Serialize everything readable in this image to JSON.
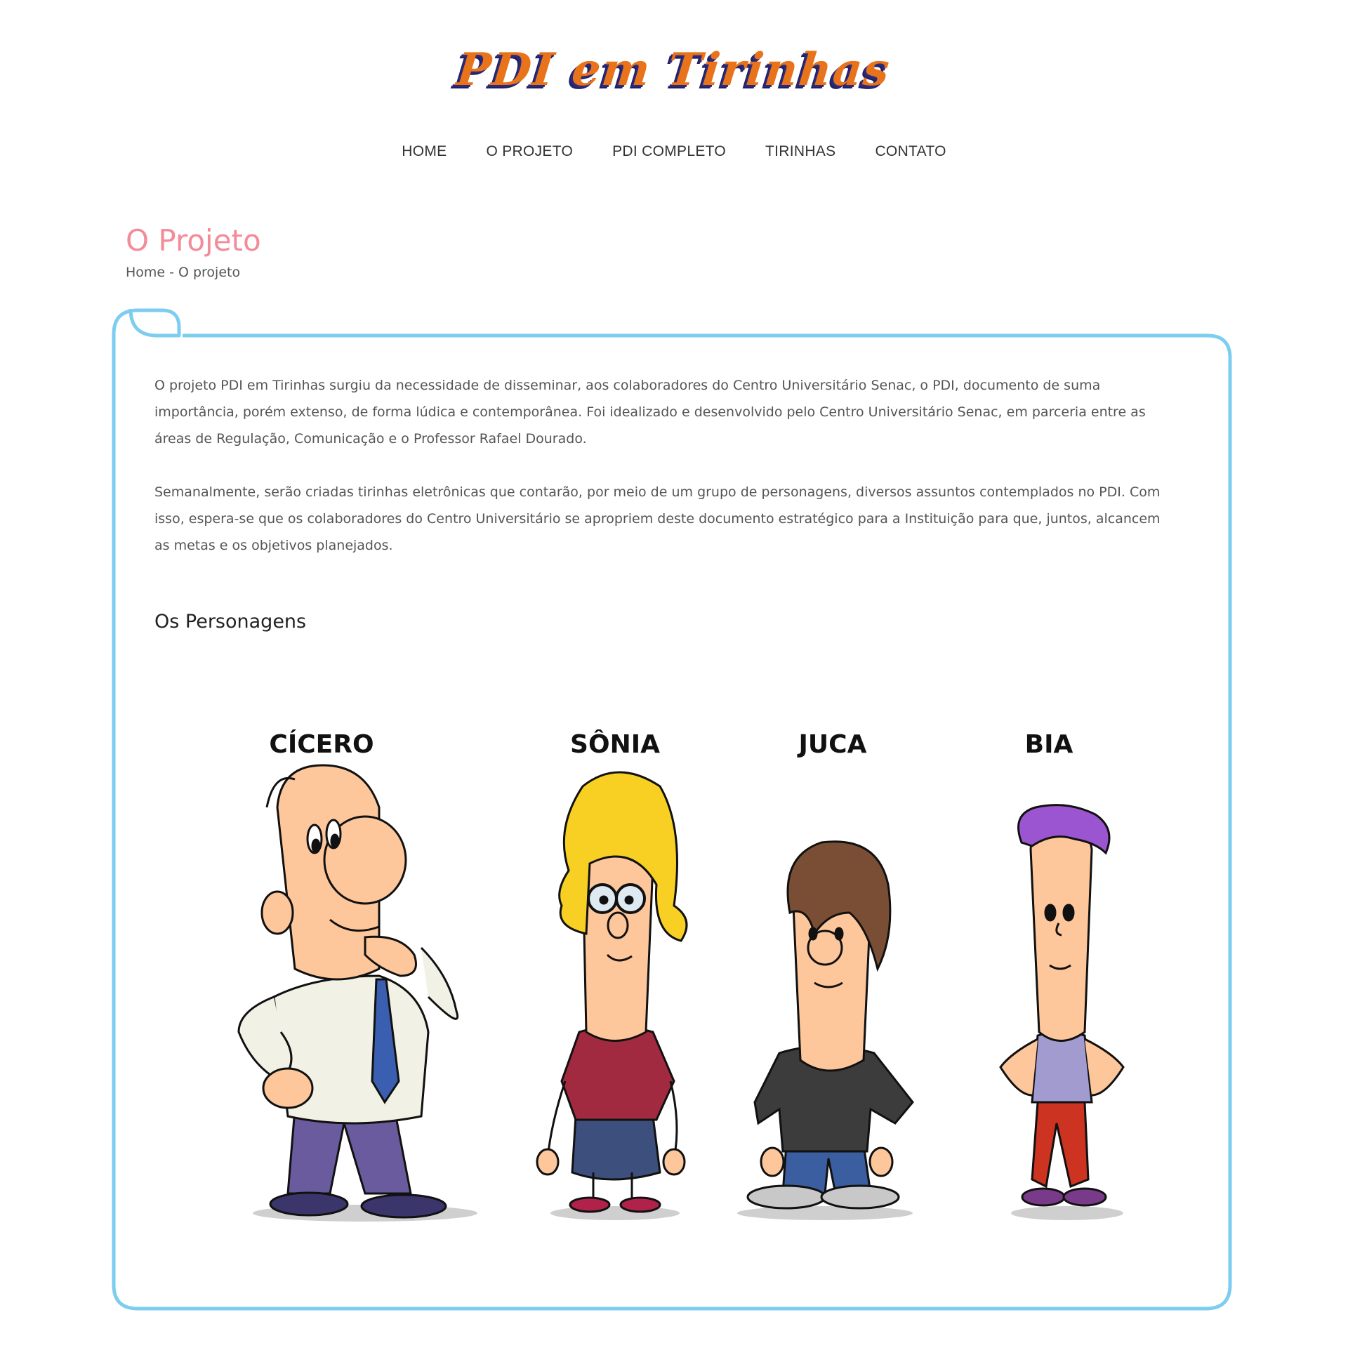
{
  "header": {
    "logo_text": "PDI em Tirinhas"
  },
  "nav": {
    "items": [
      "HOME",
      "O PROJETO",
      "PDI COMPLETO",
      "TIRINHAS",
      "CONTATO"
    ]
  },
  "page": {
    "title": "O Projeto",
    "breadcrumb": [
      "Home",
      "O projeto"
    ],
    "breadcrumb_separator": "-"
  },
  "content": {
    "paragraph_1": "O projeto PDI em Tirinhas surgiu da necessidade de disseminar, aos colaboradores do Centro Universitário Senac, o PDI, documento de suma importância, porém extenso, de forma lúdica e contemporânea. Foi idealizado e desenvolvido pelo Centro Universitário Senac, em parceria entre as áreas de Regulação, Comunicação e o Professor Rafael Dourado.",
    "paragraph_2": "Semanalmente, serão criadas tirinhas eletrônicas que contarão, por meio de um grupo de personagens, diversos assuntos contemplados no PDI. Com isso, espera-se que os colaboradores do Centro Universitário se apropriem deste documento estratégico para a Instituição para que, juntos, alcancem as metas e os objetivos planejados.",
    "section_title": "Os Personagens"
  },
  "characters": [
    "CÍCERO",
    "SÔNIA",
    "JUCA",
    "BIA"
  ],
  "colors": {
    "logo": "#e8731a",
    "logo_shadow": "#1f1f66",
    "title": "#f48b98",
    "card_border": "#7ccdf0"
  }
}
